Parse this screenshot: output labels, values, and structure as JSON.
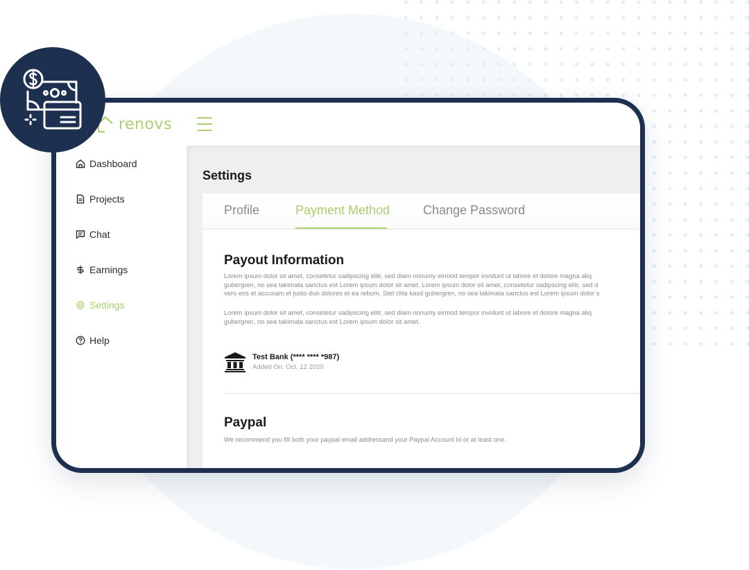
{
  "app": {
    "logo_text": "renovs",
    "accent_color": "#a9cf6e",
    "frame_color": "#1e3050"
  },
  "badge": {
    "icon": "payment-money-card-icon"
  },
  "sidebar": {
    "items": [
      {
        "label": "Dashboard",
        "icon": "home-icon",
        "active": false
      },
      {
        "label": "Projects",
        "icon": "document-icon",
        "active": false
      },
      {
        "label": "Chat",
        "icon": "chat-icon",
        "active": false
      },
      {
        "label": "Earnings",
        "icon": "dollar-icon",
        "active": false
      },
      {
        "label": "Settings",
        "icon": "gear-icon",
        "active": true
      },
      {
        "label": "Help",
        "icon": "help-icon",
        "active": false
      }
    ]
  },
  "main": {
    "title": "Settings",
    "tabs": [
      {
        "label": "Profile",
        "active": false
      },
      {
        "label": "Payment Method",
        "active": true
      },
      {
        "label": "Change Password",
        "active": false
      }
    ],
    "payout": {
      "title": "Payout Information",
      "para1": [
        "Lorem ipsum dolor sit amet, consetetur sadipscing elitr, sed diam nonumy eirmod tempor invidunt ut labore et dolore magna aliq",
        "gubergren, no sea takimata sanctus est Lorem ipsum dolor sit amet. Lorem ipsum dolor sit amet, consetetur sadipscing elitr, sed d",
        "vero eos et accusam et justo duo dolores et ea rebum. Stet clita kasd gubergren, no sea takimata sanctus est Lorem ipsum dolor s"
      ],
      "para2": [
        "Lorem ipsum dolor sit amet, consetetur sadipscing elitr, sed diam nonumy eirmod tempor invidunt ut labore et dolore magna aliq",
        "gubergren, no sea takimata sanctus est Lorem ipsum dolor sit amet."
      ],
      "bank": {
        "name": "Test Bank (**** **** *987)",
        "added": "Added On: Oct, 12 2020",
        "icon": "bank-icon"
      }
    },
    "paypal": {
      "title": "Paypal",
      "description": "We recommend you fill both your paypal email addressand your Paypal Account Id or at least one."
    }
  }
}
